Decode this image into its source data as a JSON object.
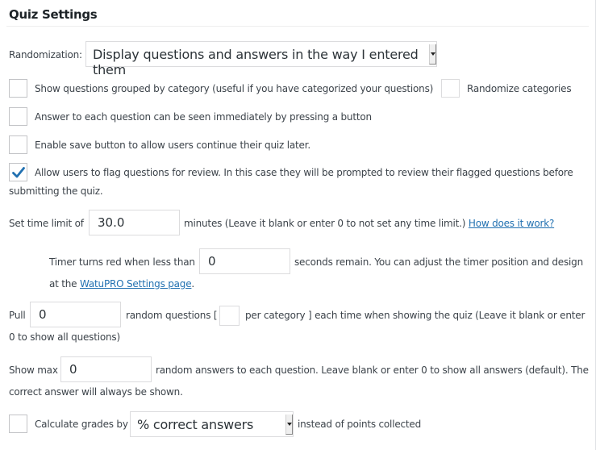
{
  "header": {
    "title": "Quiz Settings"
  },
  "randomization": {
    "label": "Randomization:",
    "selected": "Display questions and answers in the way I entered them"
  },
  "options": {
    "group_by_category": {
      "label": "Show questions grouped by category (useful if you have categorized your questions)",
      "checked": false
    },
    "randomize_categories": {
      "label": "Randomize categories",
      "checked": false
    },
    "answer_immediately": {
      "label": "Answer to each question can be seen immediately by pressing a button",
      "checked": false
    },
    "save_button": {
      "label": "Enable save button to allow users continue their quiz later.",
      "checked": false
    },
    "flag_questions": {
      "label_line1": "Allow users to flag questions for review. In this case they will be prompted to review their flagged questions before",
      "label_line2": "submitting the quiz.",
      "checked": true
    }
  },
  "time_limit": {
    "label": "Set time limit of",
    "value": "30.0",
    "suffix": "minutes (Leave it blank or enter 0 to not set any time limit.)",
    "help_link": "How does it work?"
  },
  "timer_red": {
    "label": "Timer turns red when less than",
    "value": "0",
    "suffix": "seconds remain. You can adjust the timer position and design",
    "line2_prefix": "at the",
    "settings_link": "WatuPRO Settings page",
    "line2_suffix": "."
  },
  "pull_random": {
    "label": "Pull",
    "value": "0",
    "middle": "random questions [",
    "per_category_value": "",
    "suffix": "per category ] each time when showing the quiz (Leave it blank or enter",
    "line2": "0 to show all questions)"
  },
  "show_max": {
    "label": "Show max",
    "value": "0",
    "suffix": "random answers to each question. Leave blank or enter 0 to show all answers (default). The",
    "line2": "correct answer will always be shown."
  },
  "grades": {
    "label": "Calculate grades by",
    "selected": "% correct answers",
    "suffix": "instead of points collected",
    "checked": false
  },
  "colors": {
    "link": "#2271b1",
    "check": "#2271b1"
  }
}
